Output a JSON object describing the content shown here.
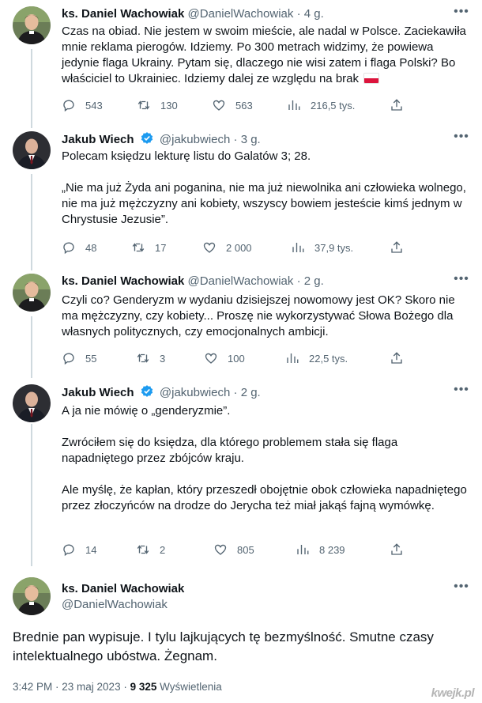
{
  "colors": {
    "text": "#0f1419",
    "secondary": "#536471",
    "verified": "#1d9bf0",
    "divider": "#eff3f4",
    "thread_line": "#cfd9de",
    "flag_white": "#ffffff",
    "flag_red": "#dc143c"
  },
  "tweets": [
    {
      "author": "ks. Daniel Wachowiak",
      "handle": "@DanielWachowiak",
      "separator": "·",
      "time": "4 g.",
      "verified": false,
      "avatar": "priest-avatar",
      "text_lines": [
        "Czas na obiad. Nie jestem w swoim mieście, ale nadal w Polsce. Zaciekawiła mnie reklama pierogów. Idziemy. Po 300 metrach widzimy, że powiewa jedynie flaga Ukrainy. Pytam się, dlaczego nie wisi zatem i flaga Polski? Bo właściciel to Ukrainiec. Idziemy dalej ze względu na brak"
      ],
      "emoji": "polish-flag",
      "replies": "543",
      "retweets": "130",
      "likes": "563",
      "views": "216,5 tys."
    },
    {
      "author": "Jakub Wiech",
      "handle": "@jakubwiech",
      "separator": "·",
      "time": "3 g.",
      "verified": true,
      "avatar": "man-in-suit-avatar",
      "text_lines": [
        "Polecam księdzu lekturę listu do Galatów 3; 28.",
        "„Nie ma już Żyda ani poganina, nie ma już niewolnika ani człowieka wolnego, nie ma już mężczyzny ani kobiety, wszyscy bowiem jesteście kimś jednym w Chrystusie Jezusie”."
      ],
      "replies": "48",
      "retweets": "17",
      "likes": "2 000",
      "views": "37,9 tys."
    },
    {
      "author": "ks. Daniel Wachowiak",
      "handle": "@DanielWachowiak",
      "separator": "·",
      "time": "2 g.",
      "verified": false,
      "avatar": "priest-avatar",
      "text_lines": [
        "Czyli co? Genderyzm w wydaniu dzisiejszej nowomowy jest OK? Skoro nie ma mężczyzny, czy kobiety... Proszę nie wykorzystywać Słowa Bożego dla własnych politycznych, czy emocjonalnych ambicji."
      ],
      "replies": "55",
      "retweets": "3",
      "likes": "100",
      "views": "22,5 tys."
    },
    {
      "author": "Jakub Wiech",
      "handle": "@jakubwiech",
      "separator": "·",
      "time": "2 g.",
      "verified": true,
      "avatar": "man-in-suit-avatar",
      "text_lines": [
        "A ja nie mówię o „genderyzmie”.",
        "Zwróciłem się do księdza, dla którego problemem stała się flaga napadniętego przez zbójców kraju.",
        "Ale myślę, że kapłan, który przeszedł obojętnie obok człowieka napadniętego przez złoczyńców na drodze do Jerycha też miał jakąś fajną wymówkę."
      ],
      "replies": "14",
      "retweets": "2",
      "likes": "805",
      "views": "8 239"
    }
  ],
  "main_tweet": {
    "author": "ks. Daniel Wachowiak",
    "handle": "@DanielWachowiak",
    "avatar": "priest-avatar",
    "text": "Brednie pan wypisuje. I tylu lajkujących tę bezmyślność. Smutne czasy intelektualnego ubóstwa. Żegnam.",
    "timestamp": "3:42 PM · 23 maj 2023 ·",
    "views_count": "9 325",
    "views_label": "Wyświetlenia"
  },
  "watermark": "kwejk.pl"
}
